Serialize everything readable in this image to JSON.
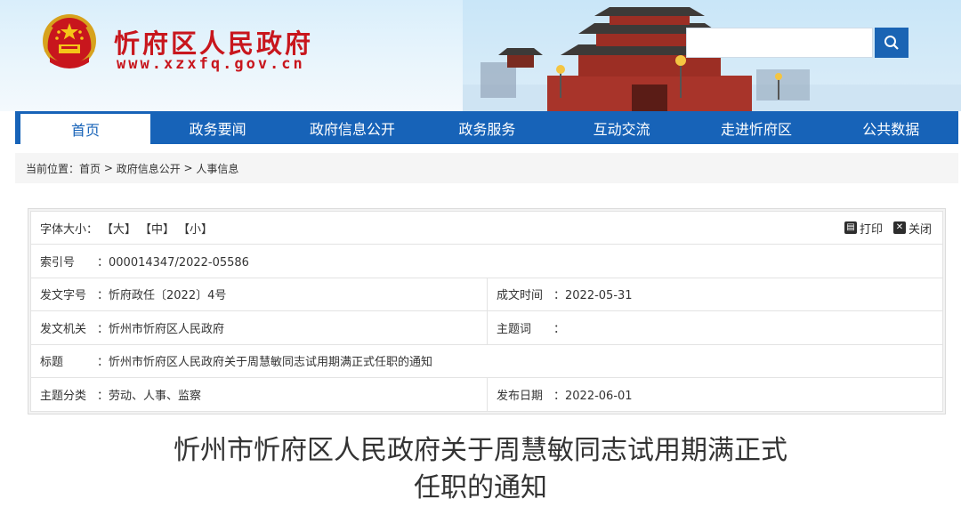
{
  "site": {
    "title": "忻府区人民政府",
    "url": "www.xzxfq.gov.cn"
  },
  "search": {
    "placeholder": "",
    "icon": "search-icon"
  },
  "nav": {
    "items": [
      {
        "label": "首页"
      },
      {
        "label": "政务要闻"
      },
      {
        "label": "政府信息公开"
      },
      {
        "label": "政务服务"
      },
      {
        "label": "互动交流"
      },
      {
        "label": "走进忻府区"
      },
      {
        "label": "公共数据"
      }
    ]
  },
  "breadcrumb": {
    "prefix": "当前位置：",
    "items": [
      "首页",
      "政府信息公开",
      "人事信息"
    ],
    "separator": " > "
  },
  "fontsize": {
    "label": "字体大小：",
    "large": "【大】",
    "medium": "【中】",
    "small": "【小】"
  },
  "tools": {
    "print": "打印",
    "close": "关闭"
  },
  "meta": {
    "index_label": "索引号",
    "index_value": "：000014347/2022-05586",
    "docno_label": "发文字号",
    "docno_value": "：忻府政任〔2022〕4号",
    "created_label": "成文时间",
    "created_value": "：2022-05-31",
    "issuer_label": "发文机关",
    "issuer_value": "：忻州市忻府区人民政府",
    "keywords_label": "主题词",
    "keywords_value": "：",
    "title_label": "标题",
    "title_value": "：忻州市忻府区人民政府关于周慧敏同志试用期满正式任职的通知",
    "category_label": "主题分类",
    "category_value": "：劳动、人事、监察",
    "published_label": "发布日期",
    "published_value": "：2022-06-01"
  },
  "document": {
    "title_line1": "忻州市忻府区人民政府关于周慧敏同志试用期满正式",
    "title_line2": "任职的通知"
  },
  "colors": {
    "brand_red": "#c8161d",
    "nav_blue": "#1763b8"
  }
}
